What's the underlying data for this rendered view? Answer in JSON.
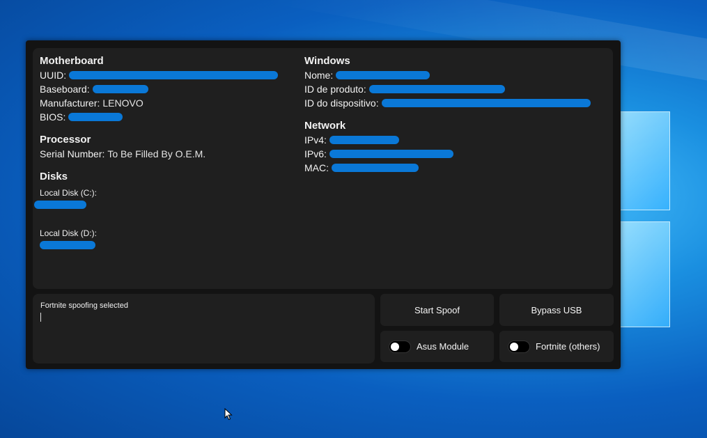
{
  "window": {
    "motherboard": {
      "title": "Motherboard",
      "uuid_label": "UUID:",
      "baseboard_label": "Baseboard:",
      "manufacturer_label": "Manufacturer:",
      "manufacturer_value": "LENOVO",
      "bios_label": "BIOS:"
    },
    "processor": {
      "title": "Processor",
      "serial_label": "Serial Number:",
      "serial_value": "To Be Filled By O.E.M."
    },
    "disks": {
      "title": "Disks",
      "items": [
        {
          "label": "Local Disk (C:):"
        },
        {
          "label": "Local Disk (D:):"
        }
      ]
    },
    "windows": {
      "title": "Windows",
      "name_label": "Nome:",
      "product_id_label": "ID de produto:",
      "device_id_label": "ID do dispositivo:"
    },
    "network": {
      "title": "Network",
      "ipv4_label": "IPv4:",
      "ipv6_label": "IPv6:",
      "mac_label": "MAC:"
    },
    "console": {
      "message": "Fortnite spoofing selected"
    },
    "buttons": {
      "start_spoof": "Start Spoof",
      "bypass_usb": "Bypass USB"
    },
    "toggles": {
      "asus_module": {
        "label": "Asus Module",
        "on": false
      },
      "fortnite_others": {
        "label": "Fortnite (others)",
        "on": false
      }
    },
    "colors": {
      "redaction": "#0a78d7",
      "panel_bg": "#1f1f1f",
      "window_bg": "#131313"
    }
  },
  "desktop": {
    "cursor_icon": "arrow-cursor-icon"
  }
}
